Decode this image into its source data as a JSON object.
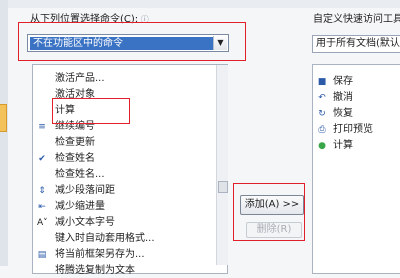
{
  "left": {
    "choose_label": "从下列位置选择命令(C):",
    "choose_value": "不在功能区中的命令",
    "commands": [
      {
        "icon": "",
        "label": "激活产品..."
      },
      {
        "icon": "",
        "label": "激活对象"
      },
      {
        "icon": "",
        "label": "计算"
      },
      {
        "icon": "number-icon",
        "label": "继续编号"
      },
      {
        "icon": "",
        "label": "检查更新"
      },
      {
        "icon": "check-name-icon",
        "label": "检查姓名"
      },
      {
        "icon": "",
        "label": "检查姓名..."
      },
      {
        "icon": "paragraph-spacing-icon",
        "label": "减少段落间距"
      },
      {
        "icon": "indent-icon",
        "label": "减少缩进量"
      },
      {
        "icon": "font-size-icon",
        "label": "减小文本字号"
      },
      {
        "icon": "",
        "label": "键入时自动套用格式..."
      },
      {
        "icon": "frame-icon",
        "label": "将当前框架另存为..."
      },
      {
        "icon": "",
        "label": "将腾选复制为文本"
      }
    ]
  },
  "buttons": {
    "add": "添加(A) >>",
    "remove": "删除(R)"
  },
  "right": {
    "qat_label": "自定义快速访问工具",
    "qat_value": "用于所有文档(默认)",
    "items": [
      {
        "icon": "save-icon",
        "label": "保存"
      },
      {
        "icon": "undo-icon",
        "label": "撤消"
      },
      {
        "icon": "redo-icon",
        "label": "恢复"
      },
      {
        "icon": "print-preview-icon",
        "label": "打印预览"
      },
      {
        "icon": "calculate-icon",
        "label": "计算"
      }
    ]
  },
  "highlight_color": "#e0202a"
}
